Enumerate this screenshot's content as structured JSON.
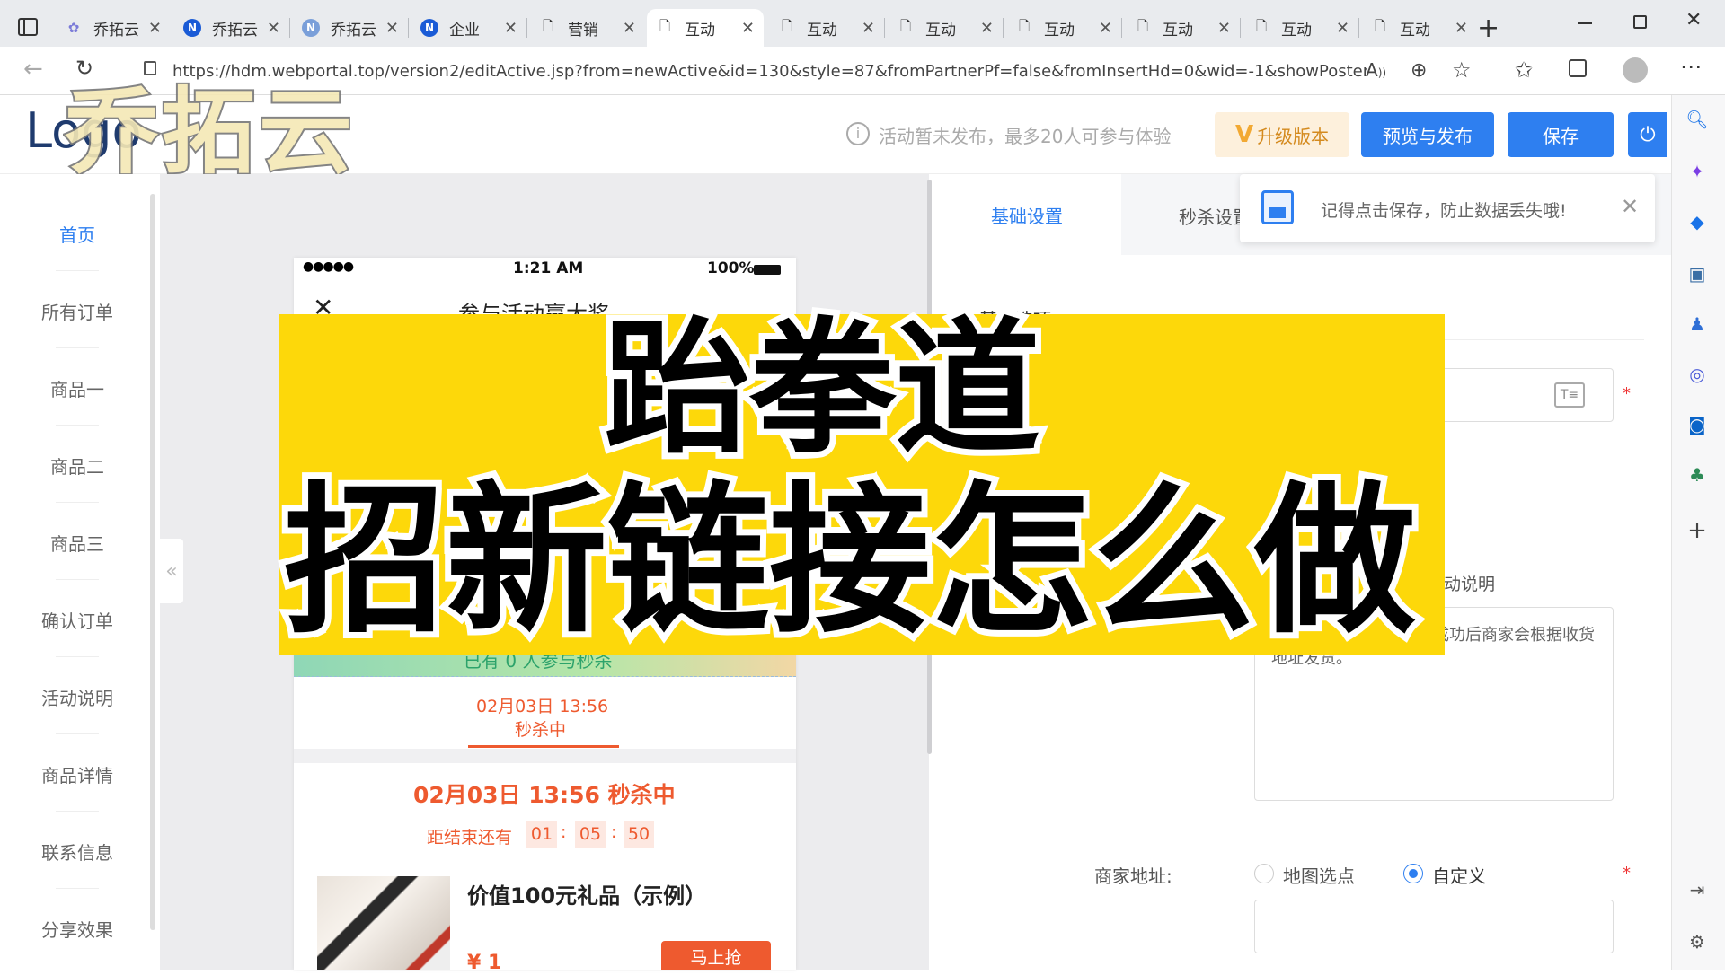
{
  "browser": {
    "tabs": [
      {
        "label": "乔拓云"
      },
      {
        "label": "乔拓云"
      },
      {
        "label": "乔拓云"
      },
      {
        "label": "企业"
      },
      {
        "label": "营销"
      },
      {
        "label": "互动"
      },
      {
        "label": "互动"
      },
      {
        "label": "互动"
      },
      {
        "label": "互动"
      },
      {
        "label": "互动"
      },
      {
        "label": "互动"
      },
      {
        "label": "互动"
      }
    ],
    "url": "https://hdm.webportal.top/version2/editActive.jsp?from=newActive&id=130&style=87&fromPartnerPf=false&fromInsertHd=0&wid=-1&showPosterSharin..."
  },
  "watermark": "乔拓云",
  "header": {
    "logo": "Logo",
    "notice": "活动暂未发布，最多20人可参与体验",
    "upgrade": "升级版本",
    "preview_publish": "预览与发布",
    "save": "保存"
  },
  "toast": {
    "text": "记得点击保存，防止数据丢失哦!"
  },
  "nav": {
    "items": [
      "首页",
      "所有订单",
      "商品一",
      "商品二",
      "商品三",
      "确认订单",
      "活动说明",
      "商品详情",
      "联系信息",
      "分享效果"
    ]
  },
  "phone": {
    "signal": "●●●●●",
    "time": "1:21 AM",
    "battery": "100%",
    "title": "参与活动赢大奖",
    "participants": "已有 0 人参与秒杀",
    "tab_date": "02月03日 13:56",
    "tab_status": "秒杀中",
    "headline": "02月03日 13:56 秒杀中",
    "countdown_label": "距结束还有",
    "countdown": [
      "01",
      "05",
      "50"
    ],
    "product_name": "价值100元礼品（示例）",
    "price": "¥ 1",
    "buy": "马上抢"
  },
  "settings": {
    "tabs": [
      "基础设置",
      "秒杀设置"
    ],
    "section": "基本选项",
    "desc_label": "活动说明",
    "desc_text": "选择商品并支付，支付成功后商家会根据收货地址发货。",
    "address_label": "商家地址:",
    "address_options": [
      "地图选点",
      "自定义"
    ],
    "address_selected": 1
  },
  "overlay": {
    "line1": "跆拳道",
    "line2": "招新链接怎么做"
  },
  "colors": {
    "accent": "#2e7ff0",
    "orange": "#ee5a2f",
    "banner": "#fdd80a"
  }
}
